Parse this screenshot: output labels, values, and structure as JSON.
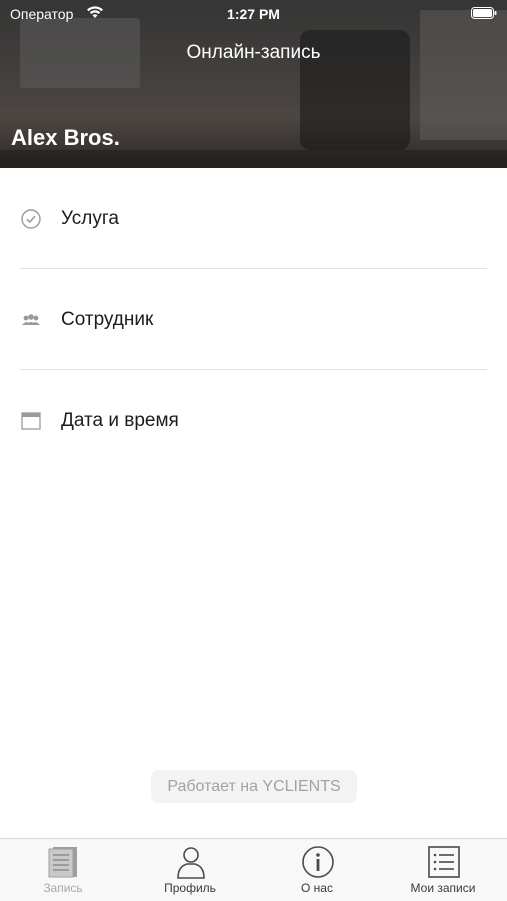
{
  "status_bar": {
    "carrier": "Оператор",
    "time": "1:27 PM"
  },
  "header": {
    "title": "Онлайн-запись",
    "company": "Alex Bros."
  },
  "steps": [
    {
      "label": "Услуга",
      "icon": "check-circle-icon"
    },
    {
      "label": "Сотрудник",
      "icon": "staff-icon"
    },
    {
      "label": "Дата и время",
      "icon": "calendar-icon"
    }
  ],
  "powered_by": "Работает на YCLIENTS",
  "tabbar": {
    "tabs": [
      {
        "label": "Запись",
        "icon": "book-icon",
        "active": false
      },
      {
        "label": "Профиль",
        "icon": "profile-icon",
        "active": true
      },
      {
        "label": "О нас",
        "icon": "info-icon",
        "active": true
      },
      {
        "label": "Мои записи",
        "icon": "list-icon",
        "active": true
      }
    ]
  }
}
